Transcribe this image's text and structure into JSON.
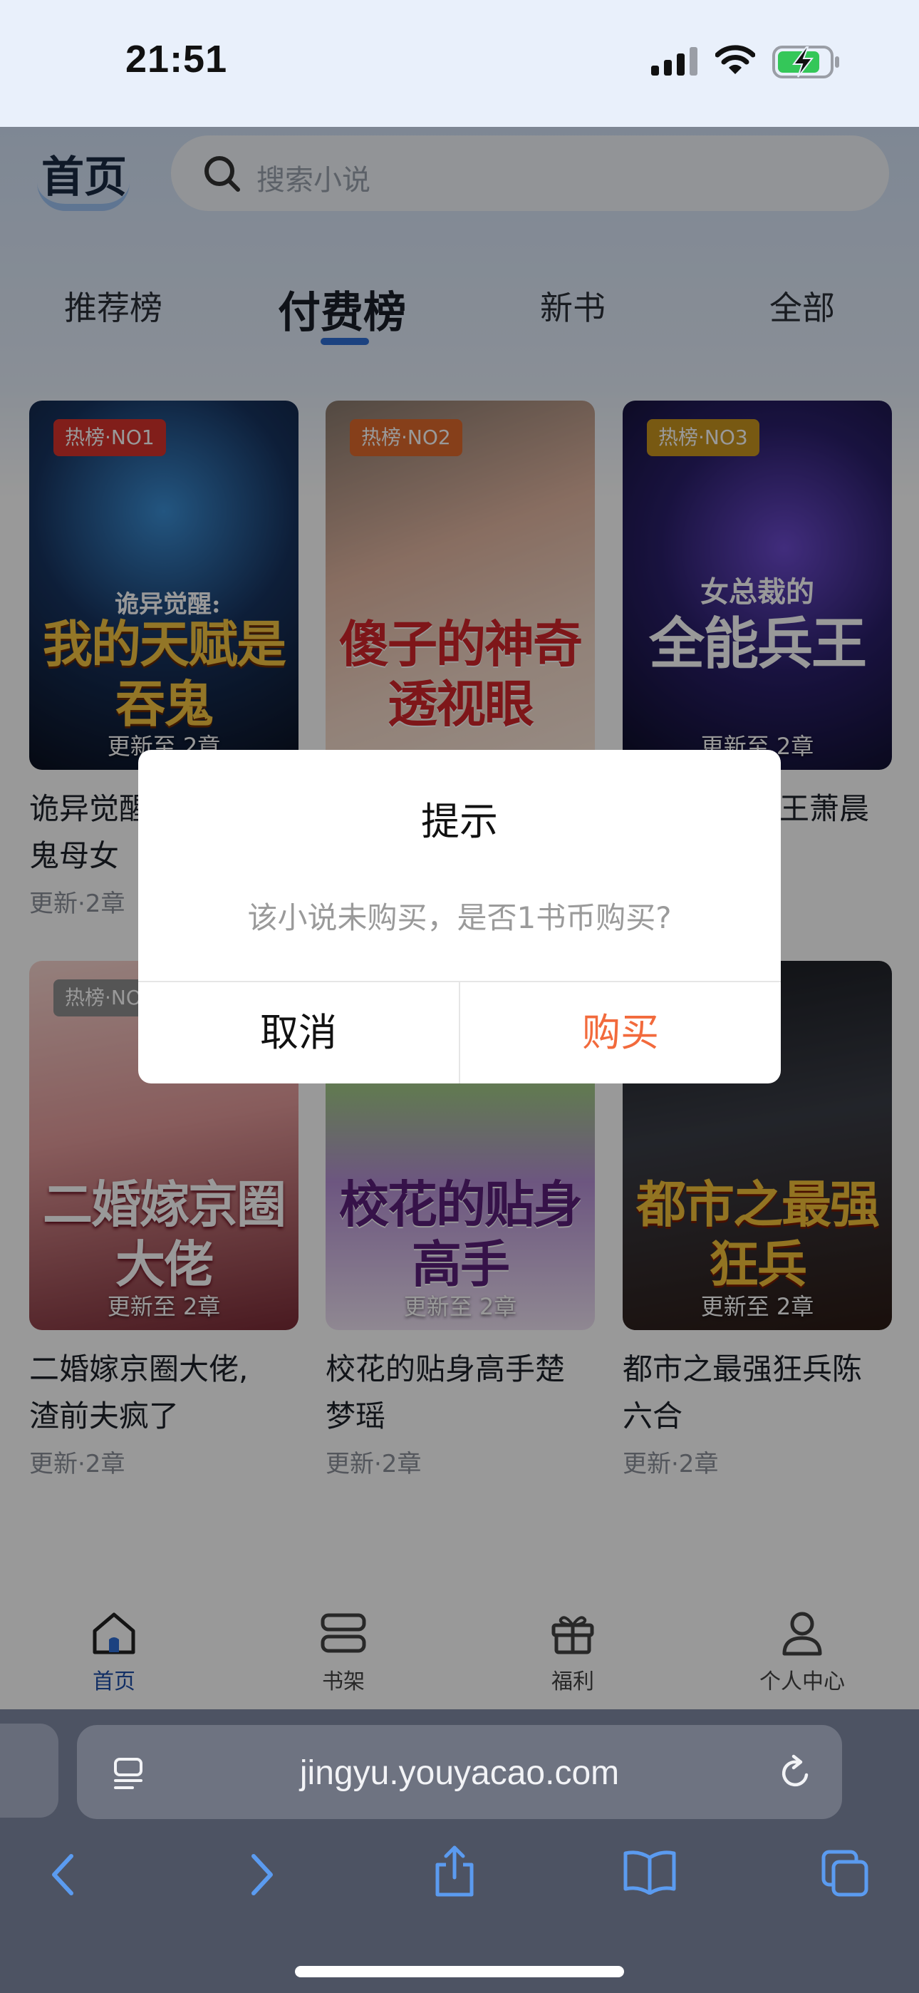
{
  "status_bar": {
    "time": "21:51"
  },
  "header": {
    "home_title": "首页",
    "search_placeholder": "搜索小说"
  },
  "tabs": [
    {
      "label": "推荐榜",
      "active": false
    },
    {
      "label": "付费榜",
      "active": true
    },
    {
      "label": "新书",
      "active": false
    },
    {
      "label": "全部",
      "active": false
    }
  ],
  "books": [
    {
      "rank_badge": "热榜·NO1",
      "cover_title": "我的天赋是吞鬼",
      "cover_subtitle": "诡异觉醒:",
      "cover_update": "更新至 2章",
      "name": "诡异觉醒：我的天赋是吞鬼母女",
      "name_visible": "诡异觉醒",
      "name_line2": "鬼母女",
      "meta": "更新·2章"
    },
    {
      "rank_badge": "热榜·NO2",
      "cover_title": "傻子的神奇透视眼",
      "cover_update": "",
      "name": "",
      "meta": ""
    },
    {
      "rank_badge": "热榜·NO3",
      "cover_title": "全能兵王",
      "cover_subtitle": "女总裁的",
      "cover_update": "更新至 2章",
      "name_visible": "王萧晨",
      "meta": ""
    },
    {
      "rank_badge": "热榜·NO",
      "cover_title": "二婚嫁京圈大佬",
      "cover_update": "更新至 2章",
      "name_line1": "二婚嫁京圈大佬,",
      "name_line2": "渣前夫疯了",
      "meta": "更新·2章"
    },
    {
      "rank_badge": "",
      "cover_title": "校花的贴身高手",
      "cover_update": "更新至 2章",
      "name_line1": "校花的贴身高手楚",
      "name_line2": "梦瑶",
      "meta": "更新·2章"
    },
    {
      "rank_badge": "",
      "cover_title": "都市之最强狂兵",
      "cover_update": "更新至 2章",
      "name_line1": "都市之最强狂兵陈",
      "name_line2": "六合",
      "meta": "更新·2章"
    }
  ],
  "bottom_nav": [
    {
      "label": "首页",
      "icon": "home-icon",
      "active": true
    },
    {
      "label": "书架",
      "icon": "bookshelf-icon",
      "active": false
    },
    {
      "label": "福利",
      "icon": "gift-icon",
      "active": false
    },
    {
      "label": "个人中心",
      "icon": "person-icon",
      "active": false
    }
  ],
  "dialog": {
    "title": "提示",
    "message": "该小说未购买，是否1书币购买?",
    "cancel_label": "取消",
    "confirm_label": "购买"
  },
  "browser": {
    "url": "jingyu.youyacao.com"
  },
  "colors": {
    "accent_blue": "#2f6fd6",
    "buy_orange": "#f26a3c",
    "safari_chrome": "#4d5363"
  }
}
